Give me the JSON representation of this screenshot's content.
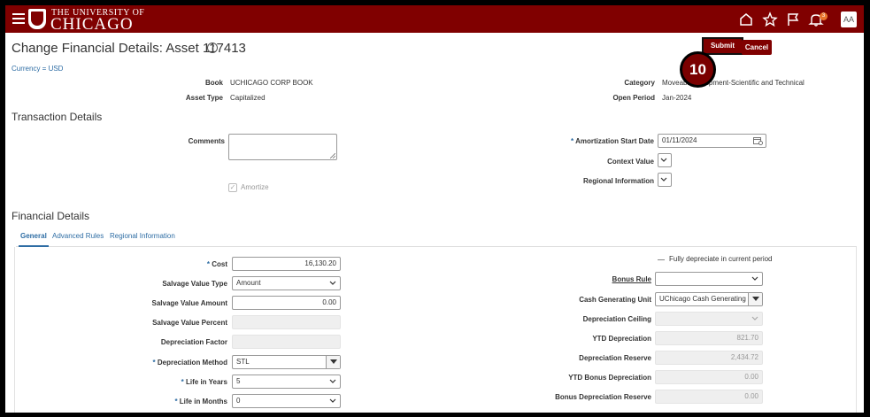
{
  "header": {
    "university_line": "THE UNIVERSITY OF",
    "university_name": "CHICAGO",
    "notification_count": "3",
    "avatar_initials": "AA"
  },
  "page": {
    "title": "Change Financial Details: Asset 117413",
    "help_glyph": "?",
    "submit_label": "Submit",
    "cancel_label": "Cancel",
    "step_number": "10",
    "currency": "Currency = USD"
  },
  "summary": {
    "book_label": "Book",
    "book_value": "UCHICAGO CORP BOOK",
    "asset_type_label": "Asset Type",
    "asset_type_value": "Capitalized",
    "category_label": "Category",
    "category_value": "Moveable Equipment-Scientific and Technical",
    "open_period_label": "Open Period",
    "open_period_value": "Jan-2024"
  },
  "transaction": {
    "section_title": "Transaction Details",
    "comments_label": "Comments",
    "amortize_label": "Amortize",
    "amort_start_label": "Amortization Start Date",
    "amort_start_value": "01/11/2024",
    "context_value_label": "Context Value",
    "regional_info_label": "Regional Information"
  },
  "financial": {
    "section_title": "Financial Details",
    "tabs": [
      "General",
      "Advanced Rules",
      "Regional Information"
    ],
    "left": {
      "cost_label": "Cost",
      "cost_value": "16,130.20",
      "salvage_type_label": "Salvage Value Type",
      "salvage_type_value": "Amount",
      "salvage_amount_label": "Salvage Value Amount",
      "salvage_amount_value": "0.00",
      "salvage_percent_label": "Salvage Value Percent",
      "dep_factor_label": "Depreciation Factor",
      "dep_method_label": "Depreciation Method",
      "dep_method_value": "STL",
      "life_years_label": "Life in Years",
      "life_years_value": "5",
      "life_months_label": "Life in Months",
      "life_months_value": "0"
    },
    "right": {
      "fully_depreciate_label": "Fully depreciate in current period",
      "bonus_rule_label": "Bonus Rule",
      "cash_gen_label": "Cash Generating Unit",
      "cash_gen_value": "UChicago Cash Generating U",
      "dep_ceiling_label": "Depreciation Ceiling",
      "ytd_dep_label": "YTD Depreciation",
      "ytd_dep_value": "821.70",
      "dep_reserve_label": "Depreciation Reserve",
      "dep_reserve_value": "2,434.72",
      "ytd_bonus_label": "YTD Bonus Depreciation",
      "ytd_bonus_value": "0.00",
      "bonus_reserve_label": "Bonus Depreciation Reserve",
      "bonus_reserve_value": "0.00"
    }
  },
  "colors": {
    "brand": "#800000",
    "link": "#2e6da4"
  }
}
